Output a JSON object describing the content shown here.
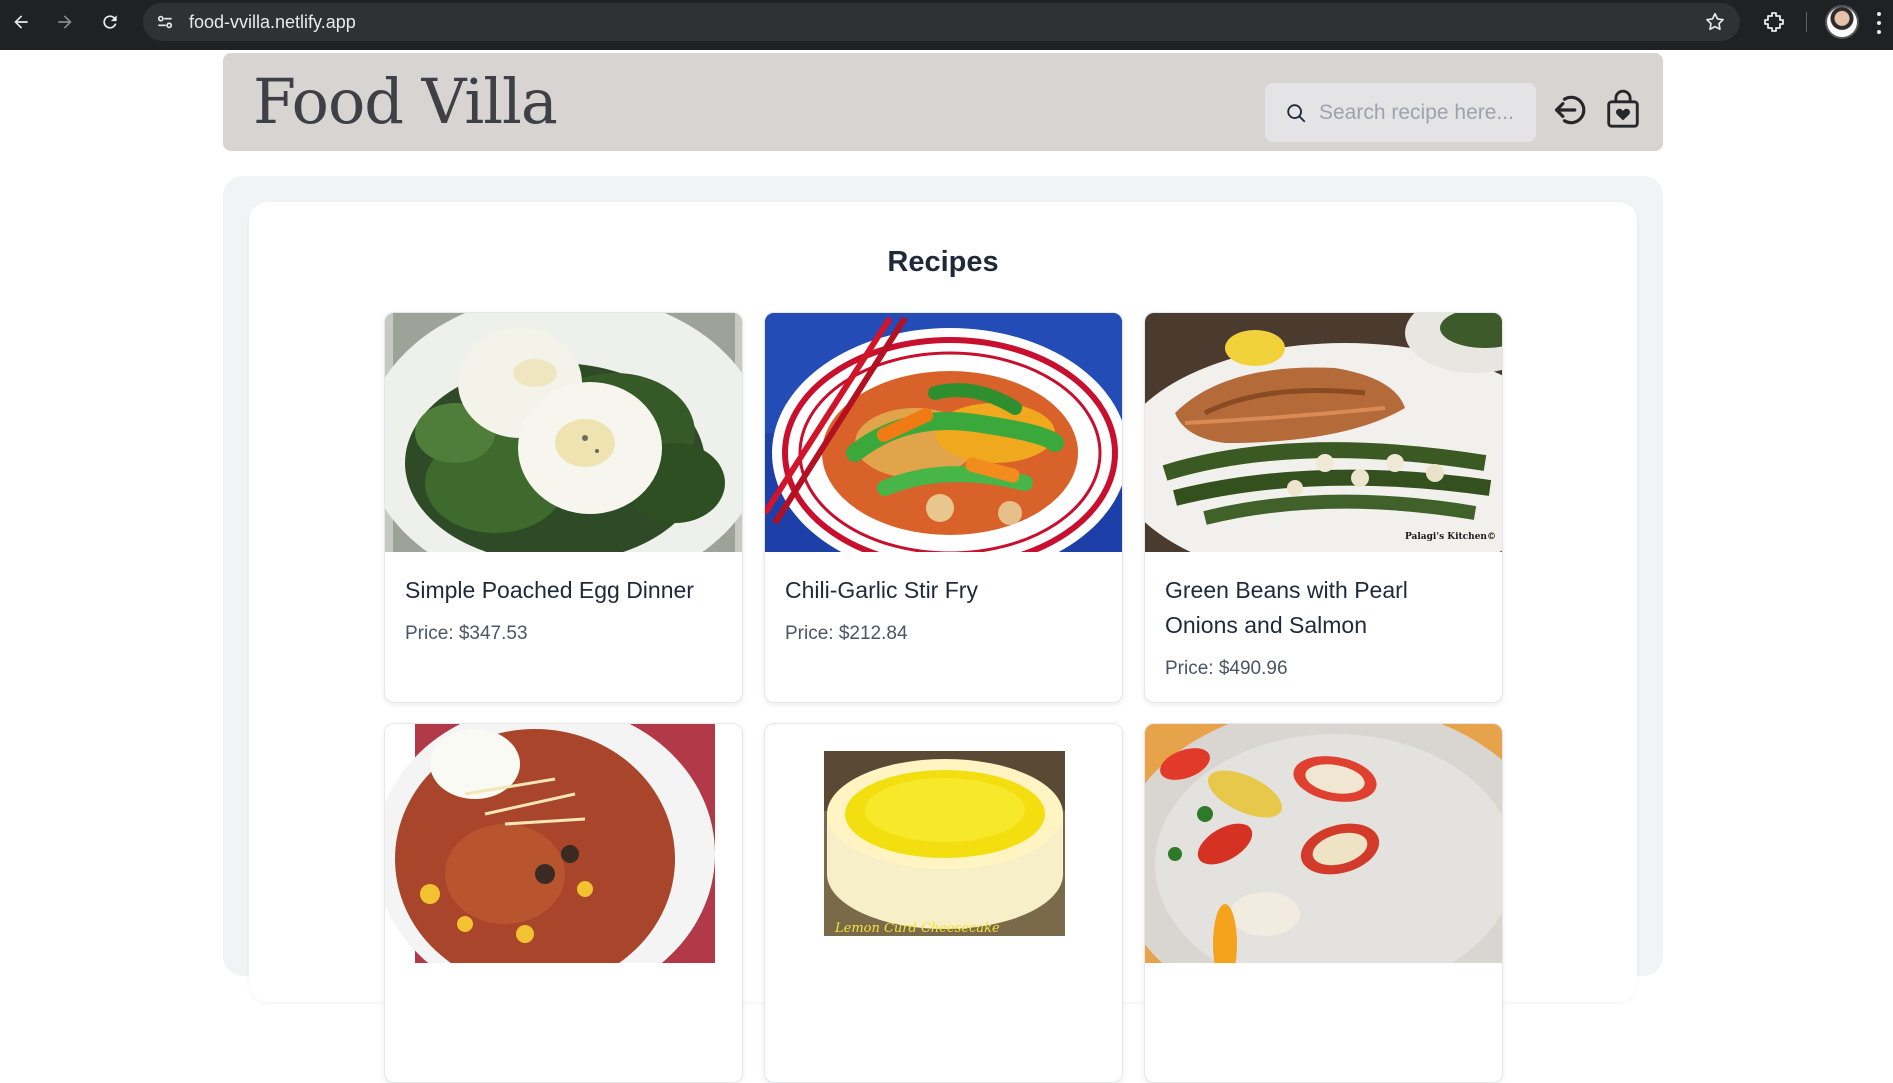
{
  "browser": {
    "url": "food-vvilla.netlify.app"
  },
  "header": {
    "brand": "Food Villa",
    "search_placeholder": "Search recipe here..."
  },
  "main": {
    "title": "Recipes",
    "recipes": [
      {
        "name": "Simple Poached Egg Dinner",
        "price": "Price: $347.53"
      },
      {
        "name": "Chili-Garlic Stir Fry",
        "price": "Price: $212.84"
      },
      {
        "name": "Green Beans with Pearl Onions and Salmon",
        "price": "Price: $490.96"
      }
    ],
    "image_watermarks": {
      "salmon": "Palagi's Kitchen©",
      "cheesecake": "Lemon Curd Cheesecake"
    }
  }
}
